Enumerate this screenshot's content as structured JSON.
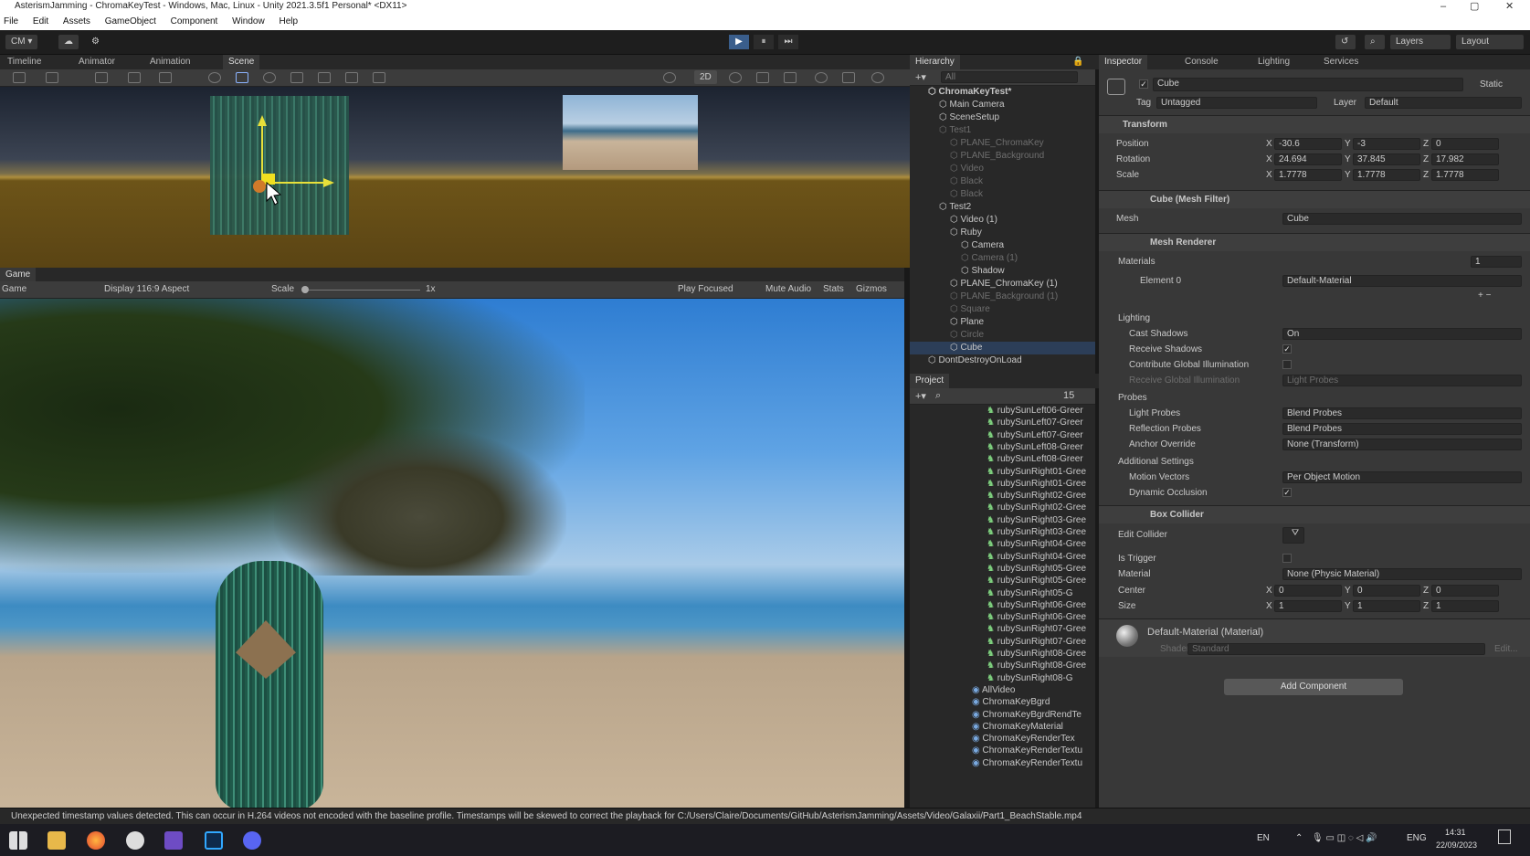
{
  "window": {
    "title": "AsterismJamming - ChromaKeyTest - Windows, Mac, Linux - Unity 2021.3.5f1 Personal* <DX11>",
    "minimize": "–",
    "maximize": "▢",
    "close": "✕"
  },
  "menu": [
    "File",
    "Edit",
    "Assets",
    "GameObject",
    "Component",
    "Window",
    "Help"
  ],
  "toolbar": {
    "account": "CM ▾",
    "layers": "Layers",
    "layout": "Layout",
    "play": "▶",
    "pause": "⏸",
    "step": "⏭"
  },
  "scene_tabs": [
    "Timeline",
    "Animator",
    "Animation",
    "Scene"
  ],
  "scene_toolbar": {
    "mode2d": "2D"
  },
  "game_tab": "Game",
  "game_toolbar": {
    "display_mode": "Game",
    "display": "Display 1",
    "aspect": "16:9 Aspect",
    "scale_label": "Scale",
    "scale_value": "1x",
    "play_focused": "Play Focused",
    "mute_audio": "Mute Audio",
    "stats": "Stats",
    "gizmos": "Gizmos"
  },
  "hierarchy": {
    "title": "Hierarchy",
    "search_placeholder": "All",
    "items": [
      {
        "label": "ChromaKeyTest*",
        "indent": 0,
        "dim": false,
        "bold": true
      },
      {
        "label": "Main Camera",
        "indent": 1,
        "dim": false
      },
      {
        "label": "SceneSetup",
        "indent": 1,
        "dim": false
      },
      {
        "label": "Test1",
        "indent": 1,
        "dim": true
      },
      {
        "label": "PLANE_ChromaKey",
        "indent": 2,
        "dim": true
      },
      {
        "label": "PLANE_Background",
        "indent": 2,
        "dim": true
      },
      {
        "label": "Video",
        "indent": 2,
        "dim": true
      },
      {
        "label": "Black",
        "indent": 2,
        "dim": true
      },
      {
        "label": "Black",
        "indent": 2,
        "dim": true
      },
      {
        "label": "Test2",
        "indent": 1,
        "dim": false
      },
      {
        "label": "Video (1)",
        "indent": 2,
        "dim": false
      },
      {
        "label": "Ruby",
        "indent": 2,
        "dim": false
      },
      {
        "label": "Camera",
        "indent": 3,
        "dim": false
      },
      {
        "label": "Camera (1)",
        "indent": 3,
        "dim": true
      },
      {
        "label": "Shadow",
        "indent": 3,
        "dim": false
      },
      {
        "label": "PLANE_ChromaKey (1)",
        "indent": 2,
        "dim": false
      },
      {
        "label": "PLANE_Background (1)",
        "indent": 2,
        "dim": true
      },
      {
        "label": "Square",
        "indent": 2,
        "dim": true
      },
      {
        "label": "Plane",
        "indent": 2,
        "dim": false
      },
      {
        "label": "Circle",
        "indent": 2,
        "dim": true
      },
      {
        "label": "Cube",
        "indent": 2,
        "dim": false,
        "selected": true
      },
      {
        "label": "DontDestroyOnLoad",
        "indent": 0,
        "dim": false
      }
    ]
  },
  "project": {
    "title": "Project",
    "count": "15",
    "items": [
      "rubySunLeft06-Greer",
      "rubySunLeft07-Greer",
      "rubySunLeft07-Greer",
      "rubySunLeft08-Greer",
      "rubySunLeft08-Greer",
      "rubySunRight01-Gree",
      "rubySunRight01-Gree",
      "rubySunRight02-Gree",
      "rubySunRight02-Gree",
      "rubySunRight03-Gree",
      "rubySunRight03-Gree",
      "rubySunRight04-Gree",
      "rubySunRight04-Gree",
      "rubySunRight05-Gree",
      "rubySunRight05-Gree",
      "rubySunRight05-G",
      "rubySunRight06-Gree",
      "rubySunRight06-Gree",
      "rubySunRight07-Gree",
      "rubySunRight07-Gree",
      "rubySunRight08-Gree",
      "rubySunRight08-Gree",
      "rubySunRight08-G",
      "AllVideo",
      "ChromaKeyBgrd",
      "ChromaKeyBgrdRendTe",
      "ChromaKeyMaterial",
      "ChromaKeyRenderTex",
      "ChromaKeyRenderTextu",
      "ChromaKeyRenderTextu"
    ]
  },
  "inspector_tabs": [
    "Inspector",
    "Console",
    "Lighting",
    "Services"
  ],
  "inspector": {
    "object_name": "Cube",
    "static": "Static",
    "tag_label": "Tag",
    "tag": "Untagged",
    "layer_label": "Layer",
    "layer": "Default",
    "transform": {
      "title": "Transform",
      "position_label": "Position",
      "rotation_label": "Rotation",
      "scale_label": "Scale",
      "position": {
        "x": "-30.6",
        "y": "-3",
        "z": "0"
      },
      "rotation": {
        "x": "24.694",
        "y": "37.845",
        "z": "17.982"
      },
      "scale": {
        "x": "1.7778",
        "y": "1.7778",
        "z": "1.7778"
      }
    },
    "mesh_filter": {
      "title": "Cube (Mesh Filter)",
      "mesh_label": "Mesh",
      "mesh": "Cube"
    },
    "mesh_renderer": {
      "title": "Mesh Renderer",
      "materials_label": "Materials",
      "materials_count": "1",
      "element0_label": "Element 0",
      "element0": "Default-Material",
      "lighting_label": "Lighting",
      "cast_shadows_label": "Cast Shadows",
      "cast_shadows": "On",
      "receive_shadows_label": "Receive Shadows",
      "contribute_gi_label": "Contribute Global Illumination",
      "receive_gi_label": "Receive Global Illumination",
      "receive_gi": "Light Probes",
      "probes_label": "Probes",
      "light_probes_label": "Light Probes",
      "light_probes": "Blend Probes",
      "reflection_probes_label": "Reflection Probes",
      "reflection_probes": "Blend Probes",
      "anchor_override_label": "Anchor Override",
      "anchor_override": "None (Transform)",
      "additional_label": "Additional Settings",
      "motion_vectors_label": "Motion Vectors",
      "motion_vectors": "Per Object Motion",
      "dynamic_occlusion_label": "Dynamic Occlusion"
    },
    "box_collider": {
      "title": "Box Collider",
      "edit_collider_label": "Edit Collider",
      "is_trigger_label": "Is Trigger",
      "material_label": "Material",
      "material": "None (Physic Material)",
      "center_label": "Center",
      "size_label": "Size",
      "center": {
        "x": "0",
        "y": "0",
        "z": "0"
      },
      "size": {
        "x": "1",
        "y": "1",
        "z": "1"
      }
    },
    "material": {
      "title": "Default-Material (Material)",
      "shader_label": "Shader",
      "shader": "Standard",
      "edit": "Edit..."
    },
    "add_component": "Add Component"
  },
  "status": "Unexpected timestamp values detected. This can occur in H.264 videos not encoded with the baseline profile. Timestamps will be skewed to correct the playback for C:/Users/Claire/Documents/GitHub/AsterismJamming/Assets/Video/Galaxii/Part1_BeachStable.mp4",
  "taskbar": {
    "lang": "EN",
    "eng": "ENG",
    "time": "14:31",
    "date": "22/09/2023"
  },
  "axis_labels": {
    "x": "X",
    "y": "Y",
    "z": "Z"
  }
}
